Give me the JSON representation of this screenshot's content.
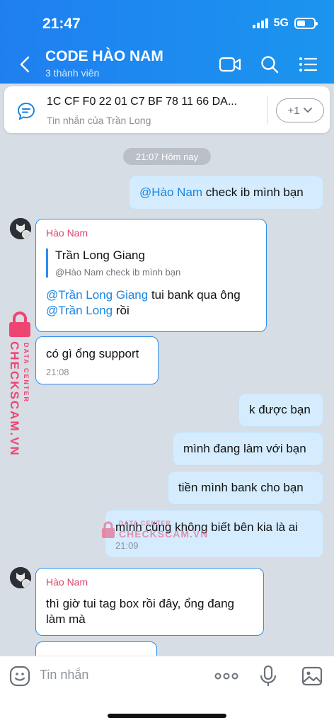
{
  "status_bar": {
    "time": "21:47",
    "network": "5G"
  },
  "header": {
    "title": "CODE HÀO NAM",
    "subtitle": "3 thành viên",
    "icons": [
      "back-icon",
      "video-call-icon",
      "search-icon",
      "list-icon"
    ]
  },
  "pinned": {
    "text": "1C CF F0 22 01 C7 BF 78 11 66 DA...",
    "sub": "Tin nhắn của Trần Long",
    "more_label": "+1"
  },
  "time_separator": "21:07 Hôm nay",
  "messages": {
    "m1": {
      "mention": "@Hào Nam",
      "text": " check ib mình bạn"
    },
    "m2": {
      "sender": "Hào Nam",
      "quote_name": "Trần Long Giang",
      "quote_text": "@Hào Nam check ib mình bạn",
      "mention1": "@Trần Long Giang",
      "text1": " tui bank qua ông",
      "mention2": "@Trần Long",
      "text2": " rồi"
    },
    "m3": {
      "text": "có gì ổng support",
      "time": "21:08"
    },
    "m4": {
      "text": "k được bạn"
    },
    "m5": {
      "text": "mình đang làm với bạn"
    },
    "m6": {
      "text": "tiền mình bank cho bạn"
    },
    "m7": {
      "text": "mình cũng không biết bên kia là ai",
      "time": "21:09"
    },
    "m8": {
      "sender": "Hào Nam",
      "line1": "thì giờ tui tag box rồi đây, ổng đang",
      "line2": "làm mà"
    }
  },
  "watermark": {
    "brand": "CHECKSCAM.VN",
    "tagline": "DATA CENTER"
  },
  "composer": {
    "placeholder": "Tin nhắn"
  },
  "colors": {
    "header": "#1f88f0",
    "accent": "#2d8ef0",
    "mention": "#1b84e0",
    "sender": "#e0446b",
    "watermark": "#ef4572"
  }
}
